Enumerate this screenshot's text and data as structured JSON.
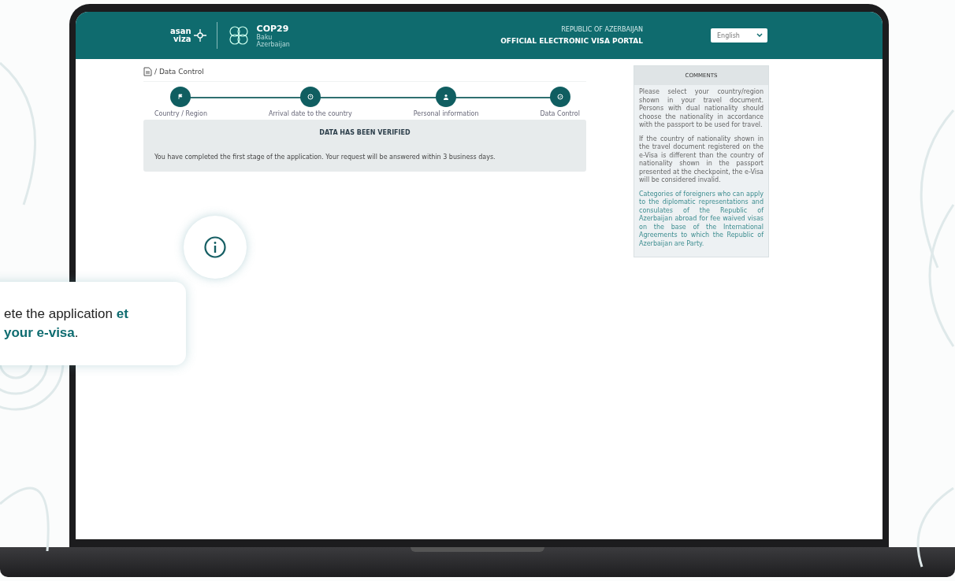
{
  "header": {
    "logo_text": [
      "asan",
      "viza"
    ],
    "event": {
      "title": "COP29",
      "subtitle": [
        "Baku",
        "Azerbaijan"
      ]
    },
    "country": "REPUBLIC OF AZERBAIJAN",
    "portal": "OFFICIAL ELECTRONIC VISA PORTAL",
    "language": "English"
  },
  "breadcrumb": "/ Data Control",
  "steps": [
    {
      "label": "Country / Region"
    },
    {
      "label": "Arrival date to the country"
    },
    {
      "label": "Personal information"
    },
    {
      "label": "Data Control"
    }
  ],
  "result": {
    "title": "DATA HAS BEEN VERIFIED",
    "message": "You have completed the first stage of the application. Your request will be answered within 3 business days."
  },
  "comments": {
    "title": "COMMENTS",
    "paragraphs": [
      {
        "text": "Please select your country/region shown in your travel document. Persons with dual nationality should choose the nationality in accordance with the passport to be used for travel.",
        "kind": "plain"
      },
      {
        "text": "If the country of nationality shown in the travel document registered on the e-Visa is different than the country of nationality shown in the passport presented at the checkpoint, the e-Visa will be considered invalid.",
        "kind": "plain"
      },
      {
        "text": "Categories of foreigners who can apply to the diplomatic representations and consulates of the Republic of Azerbaijan abroad for fee waived visas on the base of the International Agreements to which the Republic of Azerbaijan are Party.",
        "kind": "link"
      }
    ]
  },
  "callout": "ete the application **et your e-visa**."
}
